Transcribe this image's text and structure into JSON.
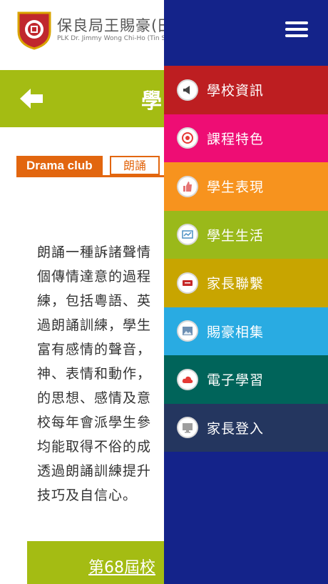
{
  "header": {
    "school_name_zh": "保良局王賜豪(田",
    "school_name_en": "PLK Dr. Jimmy Wong Chi-Ho (Tin S"
  },
  "titlebar": {
    "title": "學"
  },
  "tabs": {
    "drama": "Drama club",
    "recite": "朗誦"
  },
  "content": {
    "lines": [
      "朗誦一種訴諸聲情",
      "個傳情達意的過程",
      "練，包括粵語、英",
      "過朗誦訓練，學生",
      "富有感情的聲音，",
      "神、表情和動作，",
      "的思想、感情及意",
      "校每年會派學生參",
      "均能取得不俗的成",
      "透過朗誦訓練提升",
      "技巧及自信心。"
    ]
  },
  "bottom": {
    "link": "第68屆校"
  },
  "drawer": {
    "items": [
      {
        "label": "學校資訊",
        "icon": "megaphone-icon",
        "color": "#bd1e21"
      },
      {
        "label": "課程特色",
        "icon": "target-icon",
        "color": "#ee0d74"
      },
      {
        "label": "學生表現",
        "icon": "thumbs-up-icon",
        "color": "#f7931e"
      },
      {
        "label": "學生生活",
        "icon": "chart-icon",
        "color": "#9ab91a"
      },
      {
        "label": "家長聯繫",
        "icon": "message-icon",
        "color": "#c8a500"
      },
      {
        "label": "賜豪相集",
        "icon": "photo-icon",
        "color": "#29abe2"
      },
      {
        "label": "電子學習",
        "icon": "cloud-icon",
        "color": "#00645a"
      },
      {
        "label": "家長登入",
        "icon": "monitor-icon",
        "color": "#24365f"
      }
    ]
  },
  "colors": {
    "accent_green": "#a4bc13",
    "tab_orange": "#e2660f",
    "drawer_bg": "#14238a"
  }
}
